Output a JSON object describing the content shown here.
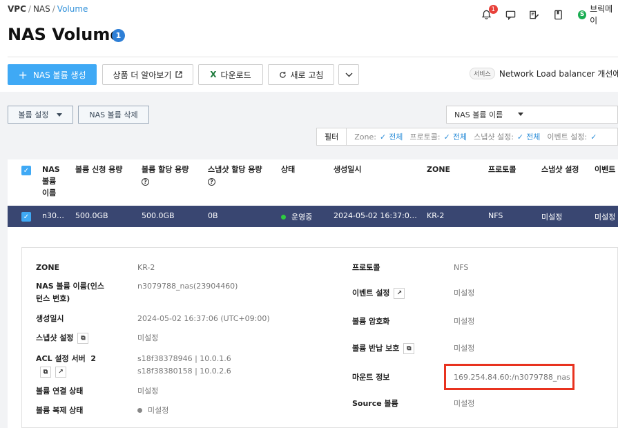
{
  "breadcrumb": {
    "a": "VPC",
    "b": "NAS",
    "c": "Volume"
  },
  "header": {
    "notification_count": "1",
    "user_badge": "S",
    "user_name": "브릭메이"
  },
  "page": {
    "title": "NAS Volume",
    "info_count": "1"
  },
  "toolbar": {
    "create": "NAS 볼륨 생성",
    "learn": "상품 더 알아보기",
    "download": "다운로드",
    "refresh": "새로 고침"
  },
  "notice": {
    "tag": "서비스",
    "text": "Network Load balancer 개선에 따"
  },
  "actions": {
    "volume_settings": "볼륨 설정",
    "delete": "NAS 볼륨 삭제"
  },
  "search": {
    "select_label": "NAS 볼륨 이름"
  },
  "filter": {
    "label": "필터",
    "items": [
      {
        "key": "Zone:",
        "value": "전체"
      },
      {
        "key": "프로토콜:",
        "value": "전체"
      },
      {
        "key": "스냅샷 설정:",
        "value": "전체"
      },
      {
        "key": "이벤트 설정:",
        "value": ""
      }
    ]
  },
  "table": {
    "headers": {
      "name": "NAS\n볼륨\n이름",
      "req": "볼륨 신청 용량",
      "alloc": "볼륨 할당 용량",
      "snap": "스냅샷 할당 용량",
      "status": "상태",
      "created": "생성일시",
      "zone": "ZONE",
      "protocol": "프로토콜",
      "snapset": "스냅샷 설정",
      "event": "이벤트"
    },
    "row": {
      "name": "n30…",
      "req": "500.0GB",
      "alloc": "500.0GB",
      "snap": "0B",
      "status": "운영중",
      "created": "2024-05-02 16:37:0…",
      "zone": "KR-2",
      "protocol": "NFS",
      "snapset": "미설정",
      "event": "미설정"
    }
  },
  "detail": {
    "zone_k": "ZONE",
    "zone_v": "KR-2",
    "name_k": "NAS 볼륨 이름(인스\n턴스 번호)",
    "name_v": "n3079788_nas(23904460)",
    "created_k": "생성일시",
    "created_v": "2024-05-02 16:37:06 (UTC+09:00)",
    "snap_k": "스냅샷 설정",
    "snap_v": "미설정",
    "acl_k": "ACL 설정 서버",
    "acl_count": "2",
    "acl_v1": "s18f38378946 | 10.0.1.6",
    "acl_v2": "s18f38380158 | 10.0.2.6",
    "conn_k": "볼륨 연결 상태",
    "conn_v": "미설정",
    "repl_k": "볼륨 복제 상태",
    "repl_v": "미설정",
    "proto_k": "프로토콜",
    "proto_v": "NFS",
    "event_k": "이벤트 설정",
    "event_v": "미설정",
    "enc_k": "볼륨 암호화",
    "enc_v": "미설정",
    "ret_k": "볼륨 반납 보호",
    "ret_v": "미설정",
    "mount_k": "마운트 정보",
    "mount_v": "169.254.84.60:/n3079788_nas",
    "src_k": "Source 볼륨",
    "src_v": "미설정"
  }
}
